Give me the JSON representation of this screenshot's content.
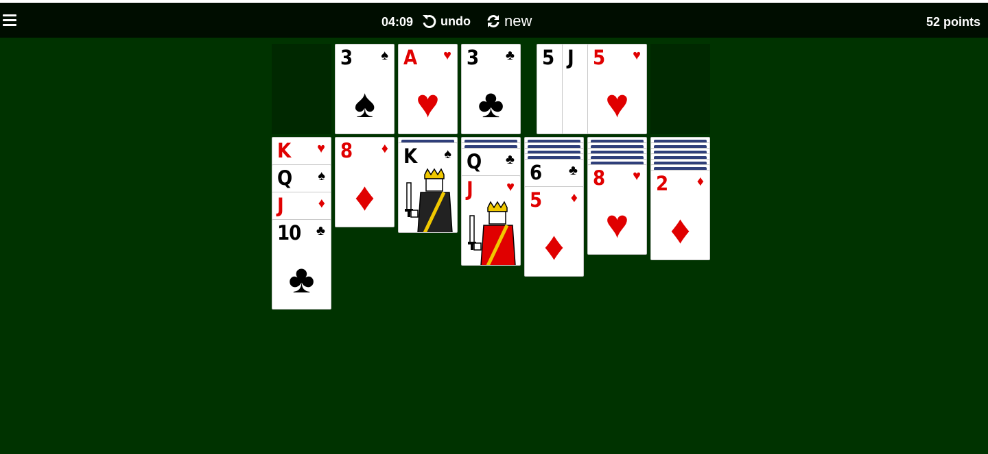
{
  "header": {
    "timer": "04:09",
    "undo_label": "undo",
    "new_label": "new",
    "score": "52 points"
  },
  "icons": {
    "menu": "hamburger-menu-icon",
    "undo": "undo-arrow-icon",
    "new": "refresh-icon"
  },
  "colors": {
    "felt": "#003300",
    "topbar": "#000d00",
    "red_suit": "#e00000",
    "card_back_stripe": "#2f3f7a"
  },
  "stock": {
    "empty": true
  },
  "waste": [
    {
      "rank": "3",
      "suit": "♠",
      "color": "black"
    }
  ],
  "foundations": [
    {
      "rank": "A",
      "suit": "♥",
      "color": "red"
    },
    {
      "rank": "3",
      "suit": "♣",
      "color": "black"
    },
    {
      "stack_visible": [
        {
          "rank": "5",
          "suit": "♠",
          "color": "black"
        },
        {
          "rank": "J",
          "suit": "♣",
          "color": "black"
        },
        {
          "rank": "5",
          "suit": "♥",
          "color": "red"
        }
      ]
    },
    {
      "empty": true
    }
  ],
  "tableau": [
    {
      "hidden": 0,
      "cards": [
        {
          "rank": "K",
          "suit": "♥",
          "color": "red"
        },
        {
          "rank": "Q",
          "suit": "♠",
          "color": "black"
        },
        {
          "rank": "J",
          "suit": "♦",
          "color": "red"
        },
        {
          "rank": "10",
          "suit": "♣",
          "color": "black"
        }
      ]
    },
    {
      "hidden": 0,
      "cards": [
        {
          "rank": "8",
          "suit": "♦",
          "color": "red"
        }
      ]
    },
    {
      "hidden": 1,
      "cards": [
        {
          "rank": "K",
          "suit": "♠",
          "color": "black"
        }
      ]
    },
    {
      "hidden": 2,
      "cards": [
        {
          "rank": "Q",
          "suit": "♣",
          "color": "black"
        },
        {
          "rank": "J",
          "suit": "♥",
          "color": "red"
        }
      ]
    },
    {
      "hidden": 4,
      "cards": [
        {
          "rank": "6",
          "suit": "♣",
          "color": "black"
        },
        {
          "rank": "5",
          "suit": "♦",
          "color": "red"
        }
      ]
    },
    {
      "hidden": 5,
      "cards": [
        {
          "rank": "8",
          "suit": "♥",
          "color": "red"
        }
      ]
    },
    {
      "hidden": 6,
      "cards": [
        {
          "rank": "2",
          "suit": "♦",
          "color": "red"
        }
      ]
    }
  ]
}
